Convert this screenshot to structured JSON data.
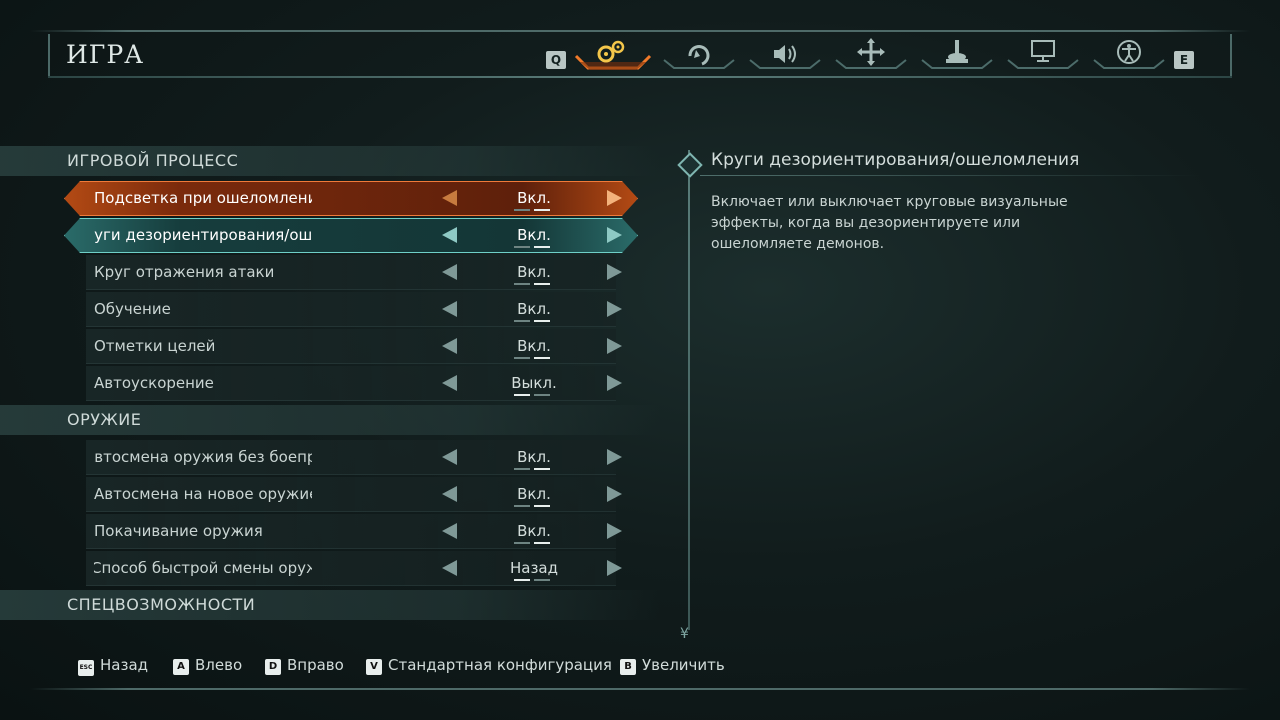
{
  "page_title": "ИГРА",
  "tabs": {
    "prev_key": "Q",
    "next_key": "E",
    "items": [
      {
        "icon": "gears-icon",
        "active": true
      },
      {
        "icon": "turbine-icon",
        "active": false
      },
      {
        "icon": "speaker-icon",
        "active": false
      },
      {
        "icon": "move-icon",
        "active": false
      },
      {
        "icon": "joystick-icon",
        "active": false
      },
      {
        "icon": "monitor-icon",
        "active": false
      },
      {
        "icon": "accessibility-icon",
        "active": false
      }
    ]
  },
  "sections": {
    "gameplay": "ИГРОВОЙ ПРОЦЕСС",
    "weapons": "ОРУЖИЕ",
    "accessibility": "СПЕЦВОЗМОЖНОСТИ"
  },
  "settings": [
    {
      "label": "Подсветка при ошеломлении",
      "value": "Вкл."
    },
    {
      "label": "Круги дезориентирования/ошеломления",
      "value": "Вкл."
    },
    {
      "label": "Круг отражения атаки",
      "value": "Вкл."
    },
    {
      "label": "Обучение",
      "value": "Вкл."
    },
    {
      "label": "Отметки целей",
      "value": "Вкл."
    },
    {
      "label": "Автоускорение",
      "value": "Выкл."
    },
    {
      "label": "Автосмена оружия без боеприпасов",
      "value": "Вкл."
    },
    {
      "label": "Автосмена на новое оружие",
      "value": "Вкл."
    },
    {
      "label": "Покачивание оружия",
      "value": "Вкл."
    },
    {
      "label": "Способ быстрой смены оружия",
      "value": "Назад"
    }
  ],
  "description": {
    "title": "Круги дезориентирования/ошеломления",
    "text": "Включает или выключает круговые визуальные эффекты, когда вы дезориентируете или ошеломляете демонов."
  },
  "footer": {
    "back": {
      "key": "ESC",
      "label": "Назад"
    },
    "left": {
      "key": "A",
      "label": "Влево"
    },
    "right": {
      "key": "D",
      "label": "Вправо"
    },
    "default": {
      "key": "V",
      "label": "Стандартная конфигурация"
    },
    "zoom": {
      "key": "B",
      "label": "Увеличить"
    }
  },
  "colors": {
    "accent_orange": "#e86a2a",
    "accent_teal": "#3fa8a2",
    "background": "#111c1c"
  }
}
